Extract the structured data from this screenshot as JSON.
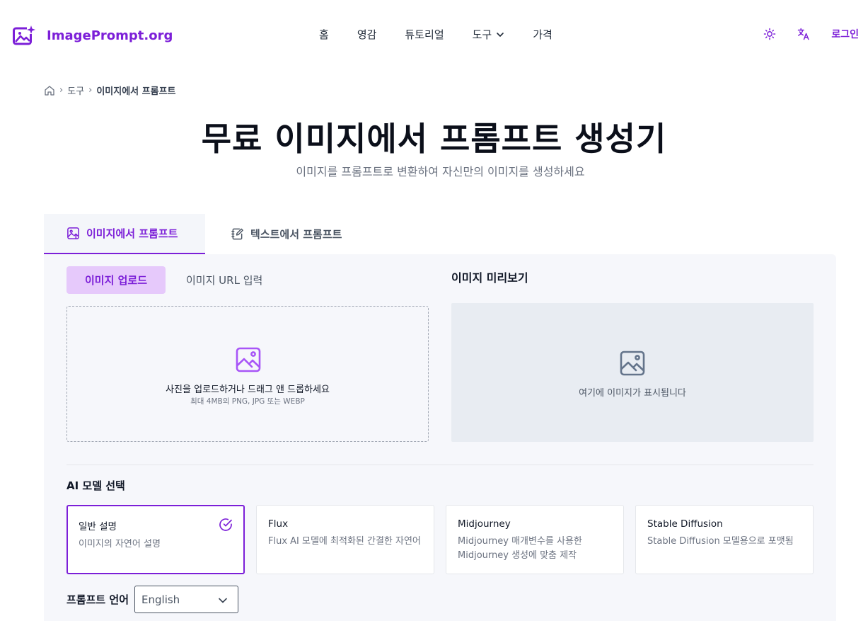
{
  "brand": {
    "name": "ImagePrompt.org",
    "color": "#7c1fd8"
  },
  "nav": {
    "items": [
      "홈",
      "영감",
      "튜토리얼",
      "도구",
      "가격"
    ],
    "login": "로그인"
  },
  "breadcrumb": {
    "tools": "도구",
    "current": "이미지에서 프롬프트"
  },
  "hero": {
    "title": "무료 이미지에서 프롬프트 생성기",
    "subtitle": "이미지를 프롬프트로 변환하여 자신만의 이미지를 생성하세요"
  },
  "tabs": [
    {
      "label": "이미지에서 프롬프트",
      "active": true
    },
    {
      "label": "텍스트에서 프롬프트",
      "active": false
    }
  ],
  "upload": {
    "subtabs": {
      "upload": "이미지 업로드",
      "url": "이미지 URL 입력"
    },
    "dropzone_text": "사진을 업로드하거나 드래그 앤 드롭하세요",
    "dropzone_hint": "최대 4MB의 PNG, JPG 또는 WEBP"
  },
  "preview": {
    "title": "이미지 미리보기",
    "placeholder": "여기에 이미지가 표시됩니다"
  },
  "models": {
    "title": "AI 모델 선택",
    "cards": [
      {
        "name": "일반 설명",
        "desc": "이미지의 자연어 설명",
        "selected": true
      },
      {
        "name": "Flux",
        "desc": "Flux AI 모델에 최적화된 간결한 자연어",
        "selected": false
      },
      {
        "name": "Midjourney",
        "desc": "Midjourney 매개변수를 사용한 Midjourney 생성에 맞춤 제작",
        "selected": false
      },
      {
        "name": "Stable Diffusion",
        "desc": "Stable Diffusion 모델용으로 포맷됨",
        "selected": false
      }
    ]
  },
  "language": {
    "label": "프롬프트 언어",
    "selected": "English"
  },
  "icons": {
    "logo": "image-sparkle-icon",
    "theme": "sun-icon",
    "translate": "translate-icon",
    "home": "home-icon",
    "upload": "image-icon",
    "check": "check-circle-icon"
  }
}
